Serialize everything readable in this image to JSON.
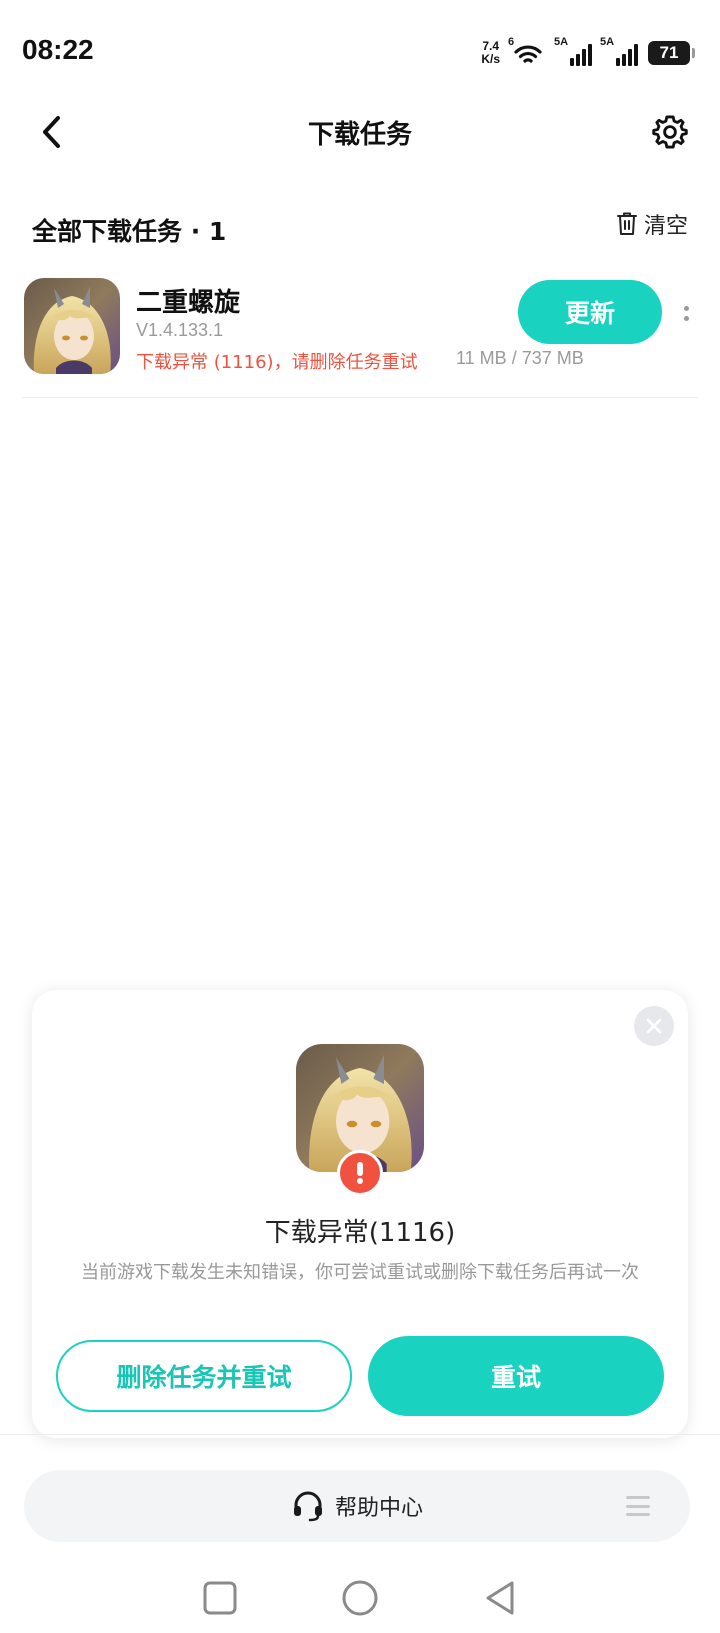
{
  "status_bar": {
    "time": "08:22",
    "net_speed_value": "7.4",
    "net_speed_unit": "K/s",
    "wifi_label": "6",
    "sim1_label": "5A",
    "sim2_label": "5A",
    "battery": "71"
  },
  "header": {
    "title": "下载任务"
  },
  "section": {
    "title": "全部下载任务 · 1",
    "clear_label": "清空"
  },
  "task": {
    "name": "二重螺旋",
    "version": "V1.4.133.1",
    "error": "下载异常 (1116)，请删除任务重试",
    "size": "11 MB / 737 MB",
    "action_label": "更新"
  },
  "dialog": {
    "title": "下载异常(1116)",
    "description": "当前游戏下载发生未知错误，你可尝试重试或删除下载任务后再试一次",
    "delete_retry_label": "删除任务并重试",
    "retry_label": "重试"
  },
  "help": {
    "label": "帮助中心"
  },
  "colors": {
    "accent": "#19d2c0",
    "error": "#f0523f"
  }
}
